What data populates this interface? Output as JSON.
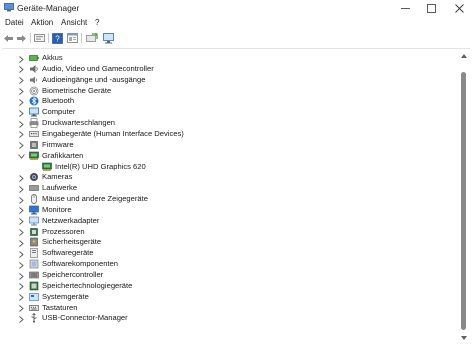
{
  "window": {
    "title": "Geräte-Manager"
  },
  "menu": {
    "items": [
      "Datei",
      "Aktion",
      "Ansicht",
      "?"
    ]
  },
  "toolbar": {
    "buttons": [
      "back-icon",
      "forward-icon",
      "show-hidden-icon",
      "help-icon",
      "properties-icon",
      "update-driver-icon",
      "scan-hardware-icon"
    ]
  },
  "tree": {
    "items": [
      {
        "label": "Akkus",
        "icon": "battery-icon",
        "expanded": false
      },
      {
        "label": "Audio, Video und Gamecontroller",
        "icon": "speaker-icon",
        "expanded": false
      },
      {
        "label": "Audioeingänge und -ausgänge",
        "icon": "audio-io-icon",
        "expanded": false
      },
      {
        "label": "Biometrische Geräte",
        "icon": "fingerprint-icon",
        "expanded": false
      },
      {
        "label": "Bluetooth",
        "icon": "bluetooth-icon",
        "expanded": false
      },
      {
        "label": "Computer",
        "icon": "computer-icon",
        "expanded": false
      },
      {
        "label": "Druckwarteschlangen",
        "icon": "printer-icon",
        "expanded": false
      },
      {
        "label": "Eingabegeräte (Human Interface Devices)",
        "icon": "hid-icon",
        "expanded": false
      },
      {
        "label": "Firmware",
        "icon": "firmware-icon",
        "expanded": false
      },
      {
        "label": "Grafikkarten",
        "icon": "display-adapter-icon",
        "expanded": true
      },
      {
        "label": "Intel(R) UHD Graphics 620",
        "icon": "display-adapter-icon",
        "child": true
      },
      {
        "label": "Kameras",
        "icon": "camera-icon",
        "expanded": false
      },
      {
        "label": "Laufwerke",
        "icon": "drive-icon",
        "expanded": false
      },
      {
        "label": "Mäuse und andere Zeigegeräte",
        "icon": "mouse-icon",
        "expanded": false
      },
      {
        "label": "Monitore",
        "icon": "monitor-icon",
        "expanded": false
      },
      {
        "label": "Netzwerkadapter",
        "icon": "network-icon",
        "expanded": false
      },
      {
        "label": "Prozessoren",
        "icon": "processor-icon",
        "expanded": false
      },
      {
        "label": "Sicherheitsgeräte",
        "icon": "security-icon",
        "expanded": false
      },
      {
        "label": "Softwaregeräte",
        "icon": "software-device-icon",
        "expanded": false
      },
      {
        "label": "Softwarekomponenten",
        "icon": "software-component-icon",
        "expanded": false
      },
      {
        "label": "Speichercontroller",
        "icon": "storage-controller-icon",
        "expanded": false
      },
      {
        "label": "Speichertechnologiegeräte",
        "icon": "storage-tech-icon",
        "expanded": false
      },
      {
        "label": "Systemgeräte",
        "icon": "system-device-icon",
        "expanded": false
      },
      {
        "label": "Tastaturen",
        "icon": "keyboard-icon",
        "expanded": false
      },
      {
        "label": "USB-Connector-Manager",
        "icon": "usb-icon",
        "expanded": false
      }
    ]
  },
  "colors": {
    "accent": "#2b78d6",
    "folder": "#e8b13a",
    "icon_gray": "#5a5a5a"
  }
}
